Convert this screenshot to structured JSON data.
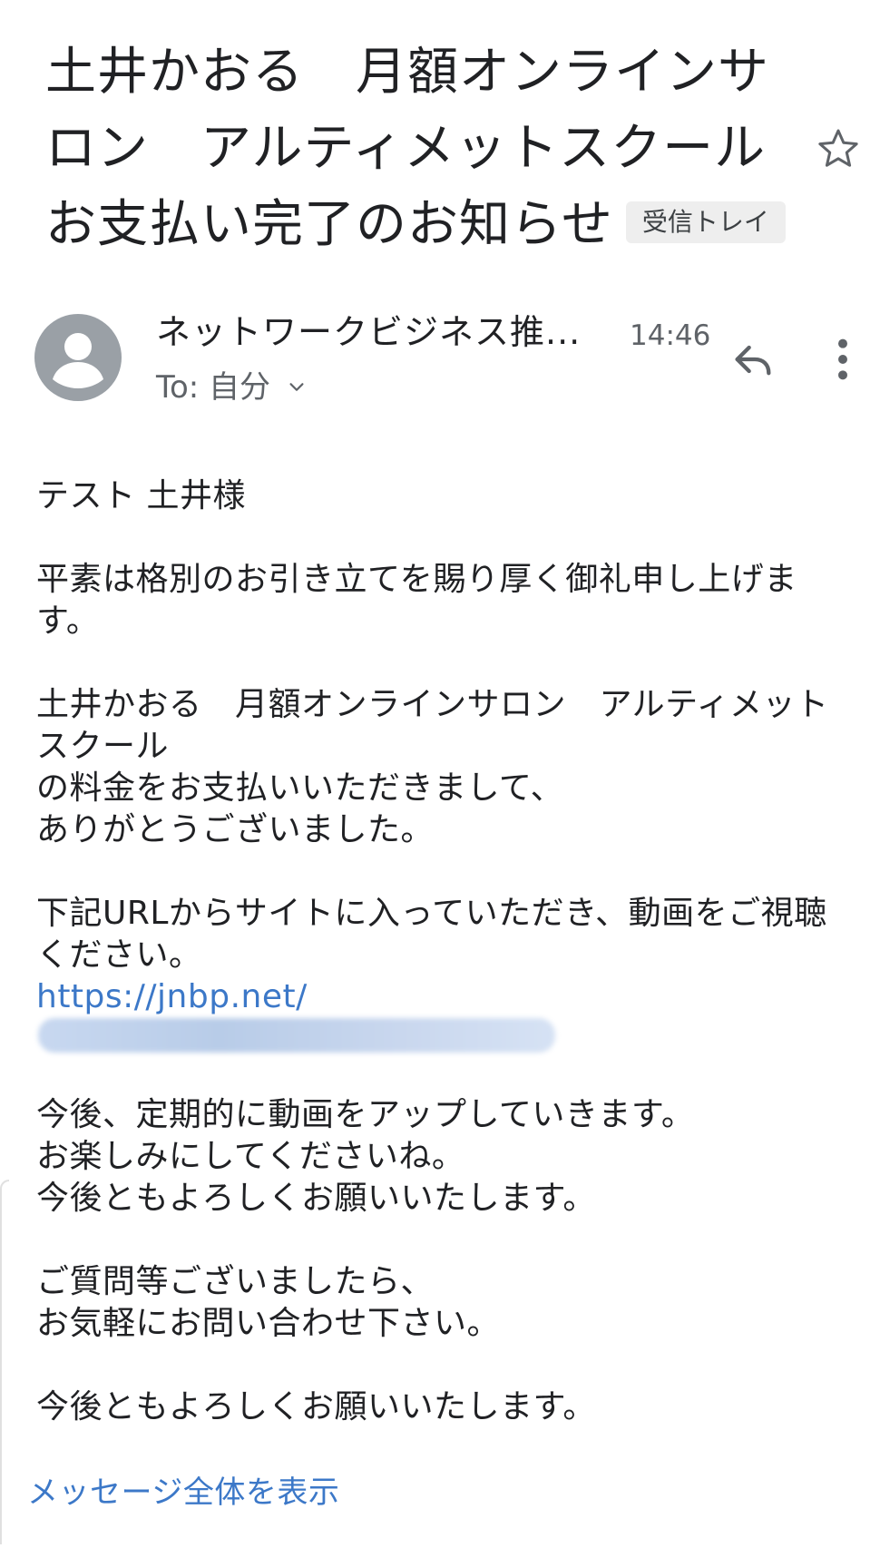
{
  "email": {
    "subject_lines": [
      "土井かおる　月額オンラインサ",
      "ロン　アルティメットスクール",
      "お支払い完了のお知らせ"
    ],
    "label": "受信トレイ",
    "sender": "ネットワークビジネス推...",
    "time": "14:46",
    "to": "To: 自分",
    "body": {
      "greeting": "テスト 土井様",
      "p1": [
        "平素は格別のお引き立てを賜り厚く御礼申し上げま",
        "す。"
      ],
      "p2": [
        "土井かおる　月額オンラインサロン　アルティメット",
        "スクール",
        "の料金をお支払いいただきまして、",
        "ありがとうございました。"
      ],
      "p3": [
        "下記URLからサイトに入っていただき、動画をご視聴",
        "ください。"
      ],
      "url": "https://jnbp.net/",
      "p4": [
        "今後、定期的に動画をアップしていきます。",
        "お楽しみにしてくださいね。",
        "今後ともよろしくお願いいたします。"
      ],
      "p5": [
        "ご質問等ございましたら、",
        "お気軽にお問い合わせ下さい。"
      ],
      "closing": "今後ともよろしくお願いいたします。"
    },
    "show_full_message": "メッセージ全体を表示"
  },
  "colors": {
    "link": "#3c78c8",
    "avatar": "#9aa0a6",
    "label_bg": "#eeeeee"
  },
  "icons": [
    "star-icon",
    "avatar-person-icon",
    "chevron-down-icon",
    "reply-icon",
    "more-vert-icon"
  ]
}
